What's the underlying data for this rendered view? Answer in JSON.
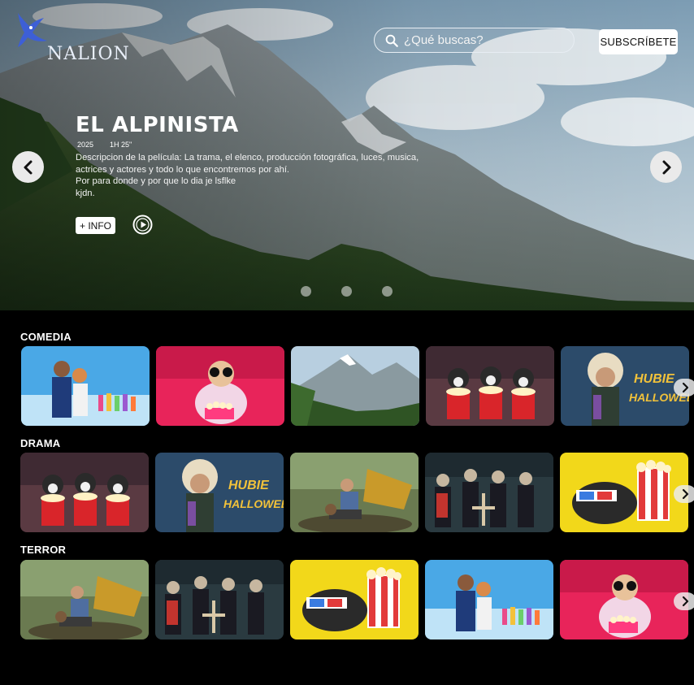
{
  "brand": {
    "name": "NALION"
  },
  "search": {
    "placeholder": "¿Qué buscas?",
    "icon": "search-icon"
  },
  "header": {
    "subscribe_label": "SUBSCRÍBETE"
  },
  "hero": {
    "title": "EL ALPINISTA",
    "year": "2025",
    "duration": "1H 25\"",
    "description_lines": [
      "Descripcion de la película: La trama, el elenco, producción fotográfica,  luces, musica,",
      "actrices y actores y todo lo que encontremos por ahí.",
      "Por para donde y por que lo dia je lsflke",
      "kjdn."
    ],
    "info_label": "+ INFO",
    "slides": 3
  },
  "rows": [
    {
      "title": "COMEDIA",
      "cards": [
        "couple-poster",
        "dog-popcorn-sofa",
        "mountain-forest",
        "three-dogs-popcorn",
        "hubie-halloween"
      ]
    },
    {
      "title": "DRAMA",
      "cards": [
        "three-dogs-popcorn",
        "hubie-halloween",
        "forest-fight",
        "zombie-group",
        "dog-3d-glasses"
      ]
    },
    {
      "title": "TERROR",
      "cards": [
        "forest-fight",
        "zombie-group",
        "dog-3d-glasses",
        "couple-poster",
        "dog-popcorn-sofa"
      ]
    }
  ],
  "colors": {
    "accent": "#ffffff",
    "background": "#000000"
  }
}
